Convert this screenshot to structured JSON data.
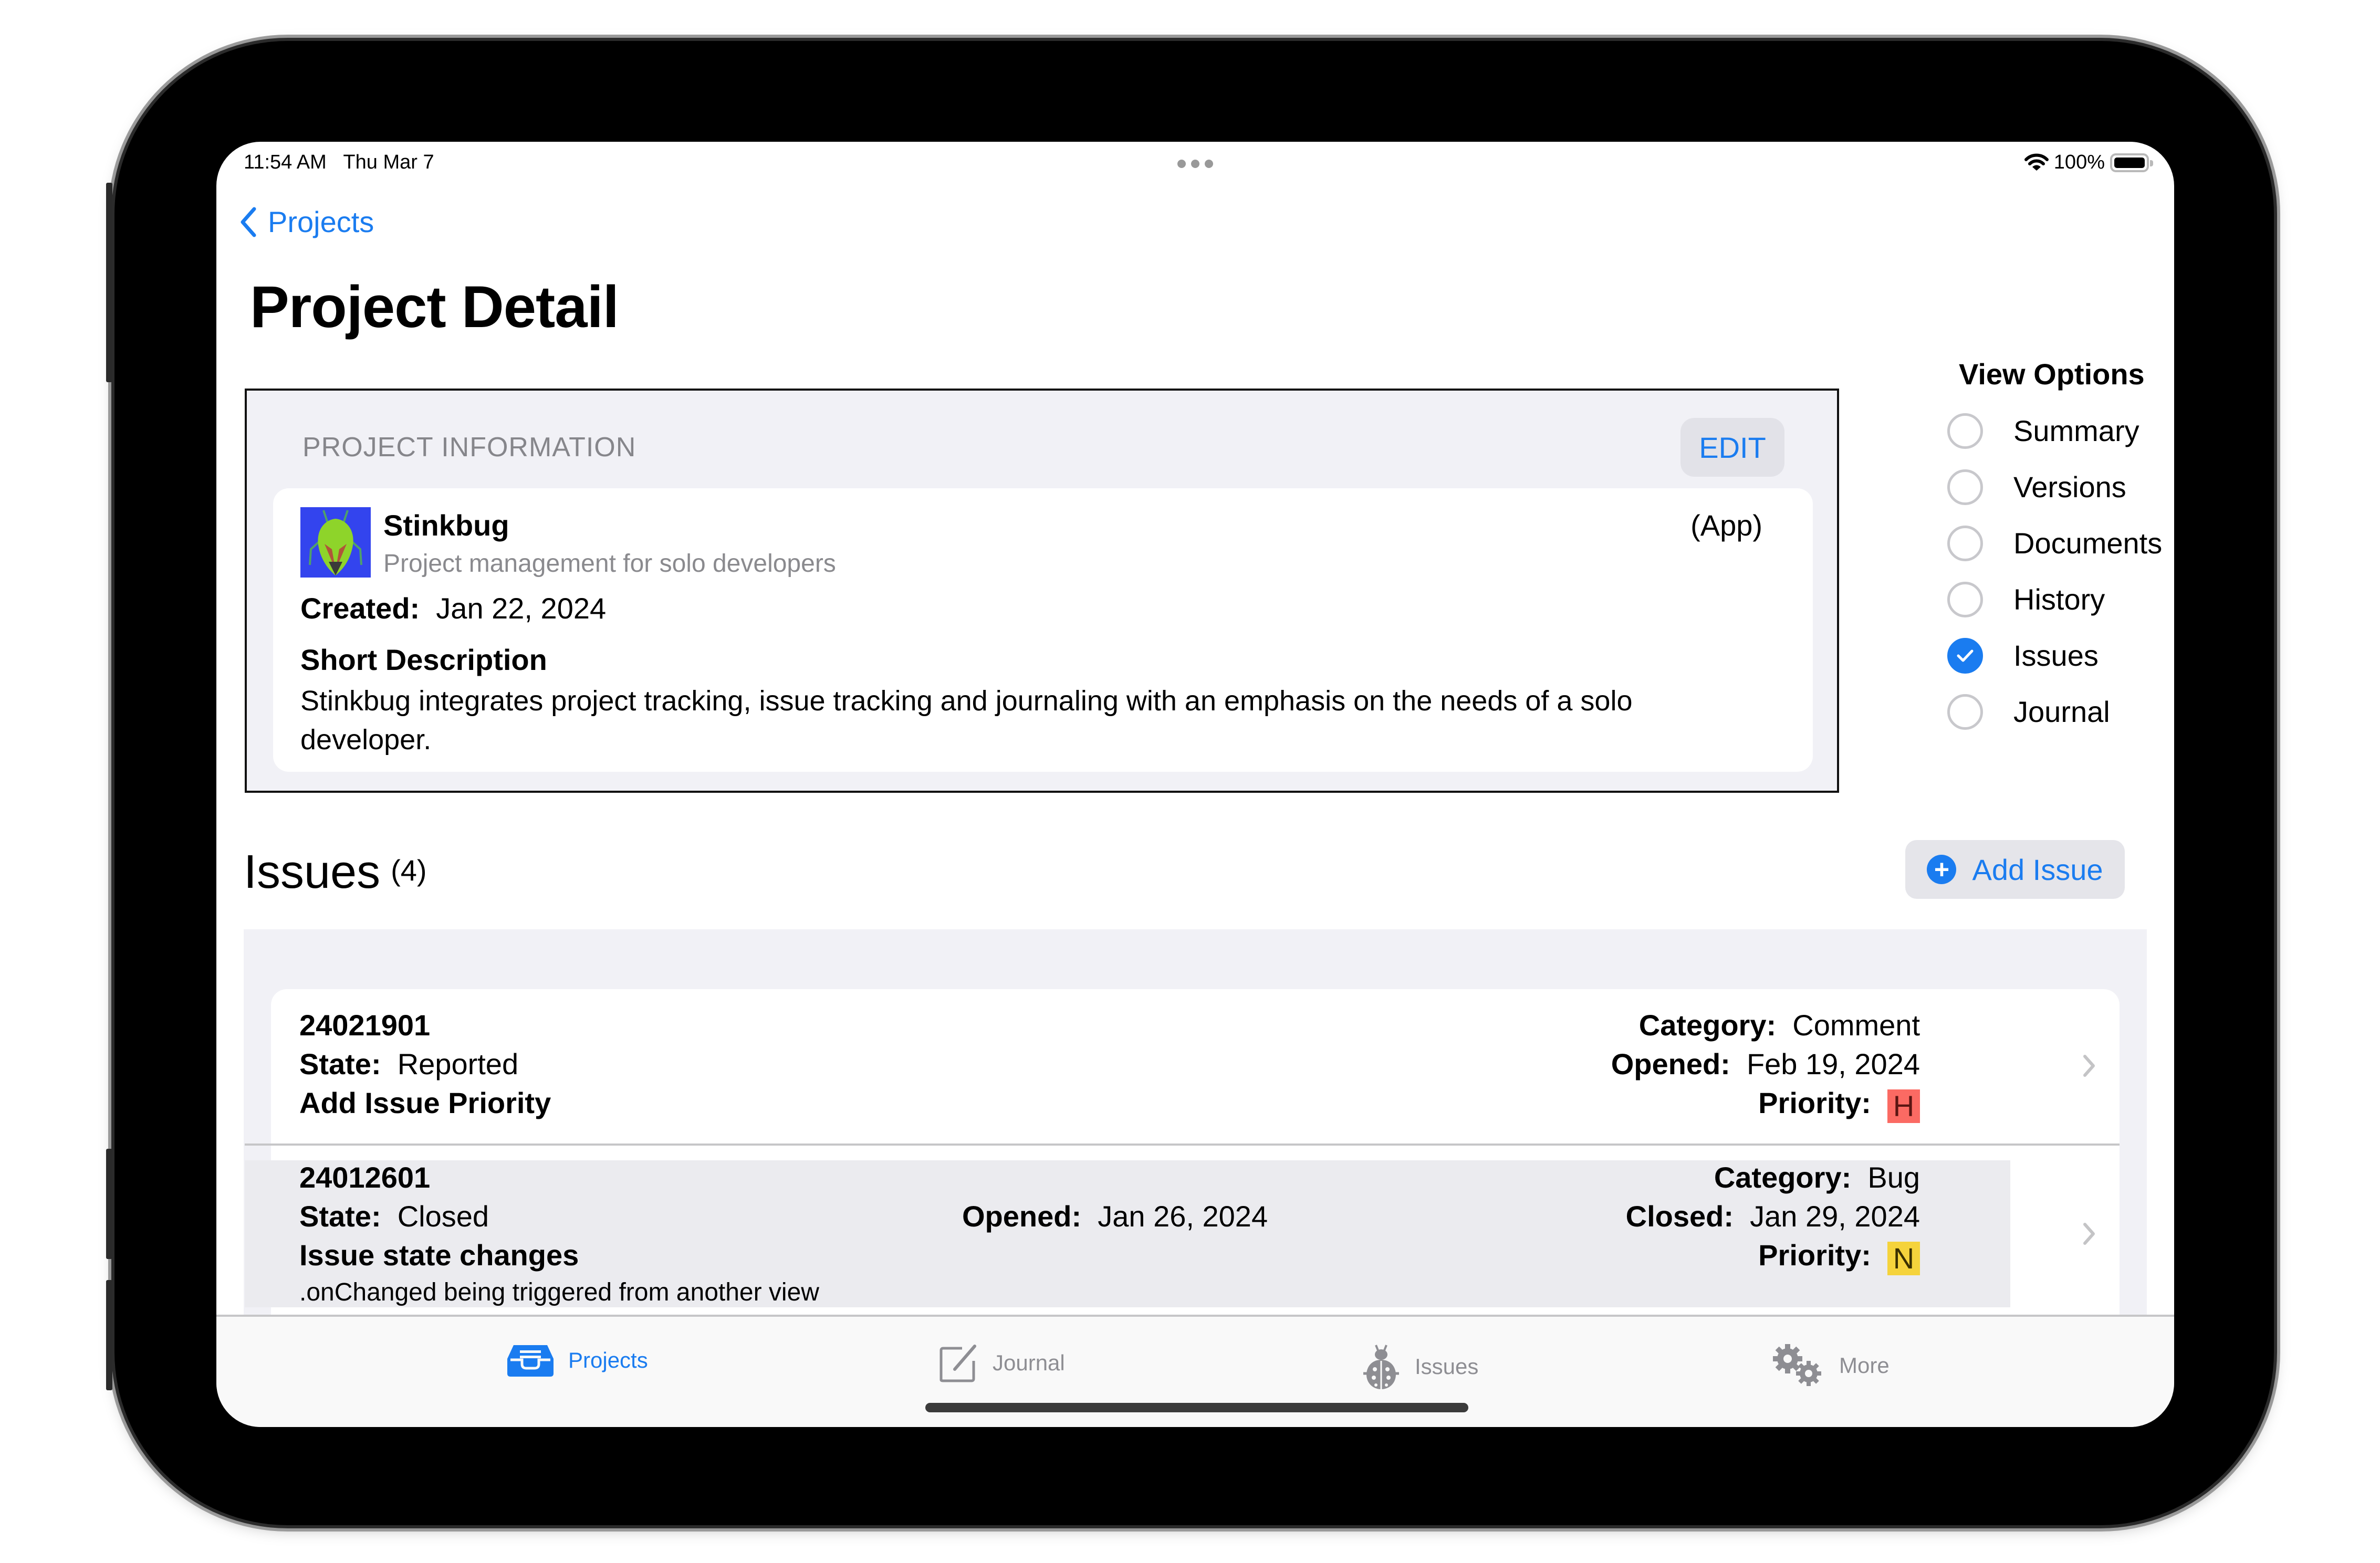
{
  "status_bar": {
    "time": "11:54 AM",
    "date": "Thu Mar 7",
    "battery_percent": "100%",
    "wifi_icon": "wifi-icon",
    "battery_icon": "battery-full-icon"
  },
  "nav": {
    "back_label": "Projects",
    "title": "Project Detail"
  },
  "project_info": {
    "section_header": "PROJECT INFORMATION",
    "edit_label": "EDIT",
    "icon": "stinkbug-app-icon",
    "name": "Stinkbug",
    "subtitle": "Project management for solo developers",
    "type": "(App)",
    "created_label": "Created:",
    "created_value": "Jan 22, 2024",
    "short_description_label": "Short Description",
    "short_description": "Stinkbug integrates project tracking, issue tracking and journaling with an emphasis on the needs of a solo developer."
  },
  "view_options": {
    "title": "View Options",
    "selected": "Issues",
    "items": [
      {
        "label": "Summary",
        "checked": false
      },
      {
        "label": "Versions",
        "checked": false
      },
      {
        "label": "Documents",
        "checked": false
      },
      {
        "label": "History",
        "checked": false
      },
      {
        "label": "Issues",
        "checked": true
      },
      {
        "label": "Journal",
        "checked": false
      }
    ]
  },
  "issues": {
    "title": "Issues",
    "count": "(4)",
    "add_label": "Add Issue",
    "items": [
      {
        "id": "24021901",
        "state_label": "State:",
        "state": "Reported",
        "title": "Add Issue Priority",
        "category_label": "Category:",
        "category": "Comment",
        "opened_label": "Opened:",
        "opened": "Feb 19, 2024",
        "priority_label": "Priority:",
        "priority": "H",
        "priority_color": "#fb6a63"
      },
      {
        "id": "24012601",
        "state_label": "State:",
        "state": "Closed",
        "title": "Issue state changes",
        "note": ".onChanged being triggered from another view",
        "category_label": "Category:",
        "category": "Bug",
        "opened_label": "Opened:",
        "opened": "Jan 26, 2024",
        "closed_label": "Closed:",
        "closed": "Jan 29, 2024",
        "priority_label": "Priority:",
        "priority": "N",
        "priority_color": "#f5d33c"
      }
    ]
  },
  "tab_bar": {
    "selected": "Projects",
    "accent_color": "#1a7cf0",
    "inactive_color": "#8e8e93",
    "tabs": [
      {
        "label": "Projects",
        "icon": "tray-icon"
      },
      {
        "label": "Journal",
        "icon": "square-pencil-icon"
      },
      {
        "label": "Issues",
        "icon": "ladybug-icon"
      },
      {
        "label": "More",
        "icon": "gears-icon"
      }
    ]
  }
}
